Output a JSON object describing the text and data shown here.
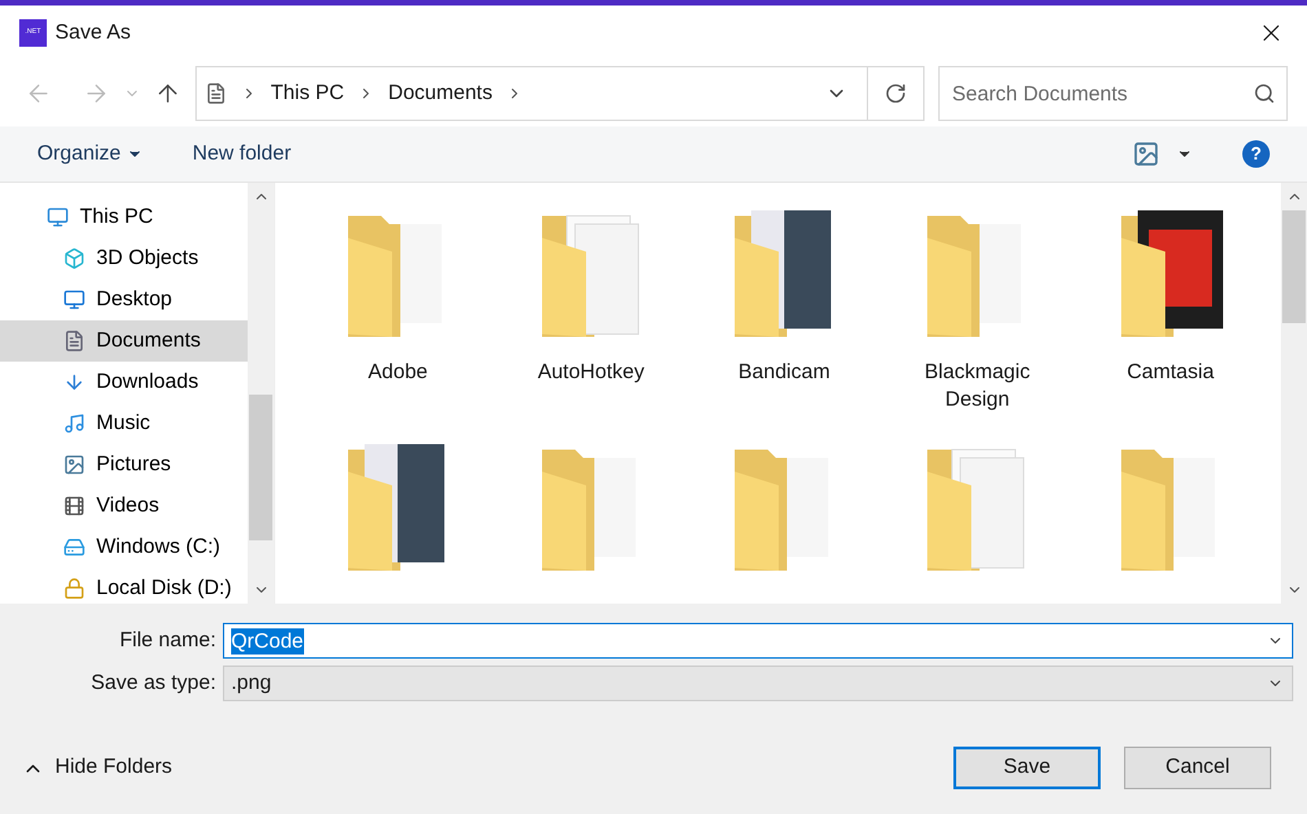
{
  "window": {
    "title": "Save As",
    "app_badge": ".NET"
  },
  "address": {
    "crumbs": [
      "This PC",
      "Documents"
    ]
  },
  "search": {
    "placeholder": "Search Documents"
  },
  "toolbar": {
    "organize": "Organize",
    "new_folder": "New folder",
    "help": "?"
  },
  "sidebar": {
    "items": [
      {
        "label": "This PC",
        "kind": "pc",
        "selected": false,
        "children": [
          {
            "label": "3D Objects",
            "kind": "cube",
            "selected": false
          },
          {
            "label": "Desktop",
            "kind": "desktop",
            "selected": false
          },
          {
            "label": "Documents",
            "kind": "document",
            "selected": true
          },
          {
            "label": "Downloads",
            "kind": "download",
            "selected": false
          },
          {
            "label": "Music",
            "kind": "music",
            "selected": false
          },
          {
            "label": "Pictures",
            "kind": "pictures",
            "selected": false
          },
          {
            "label": "Videos",
            "kind": "videos",
            "selected": false
          },
          {
            "label": "Windows (C:)",
            "kind": "drive",
            "selected": false
          },
          {
            "label": "Local Disk (D:)",
            "kind": "locked-drive",
            "selected": false
          }
        ]
      }
    ]
  },
  "folders": [
    {
      "label": "Adobe",
      "kind": "folder"
    },
    {
      "label": "AutoHotkey",
      "kind": "papers"
    },
    {
      "label": "Bandicam",
      "kind": "photo"
    },
    {
      "label": "Blackmagic Design",
      "kind": "folder"
    },
    {
      "label": "Camtasia",
      "kind": "film"
    },
    {
      "kind": "photo"
    },
    {
      "kind": "folder"
    },
    {
      "kind": "folder"
    },
    {
      "kind": "papers"
    },
    {
      "kind": "folder"
    }
  ],
  "file_name": {
    "label": "File name:",
    "value": "QrCode"
  },
  "save_type": {
    "label": "Save as type:",
    "value": ".png"
  },
  "hide_folders": "Hide Folders",
  "buttons": [
    {
      "label": "Save",
      "kind": "primary"
    },
    {
      "label": "Cancel",
      "kind": "secondary"
    }
  ]
}
